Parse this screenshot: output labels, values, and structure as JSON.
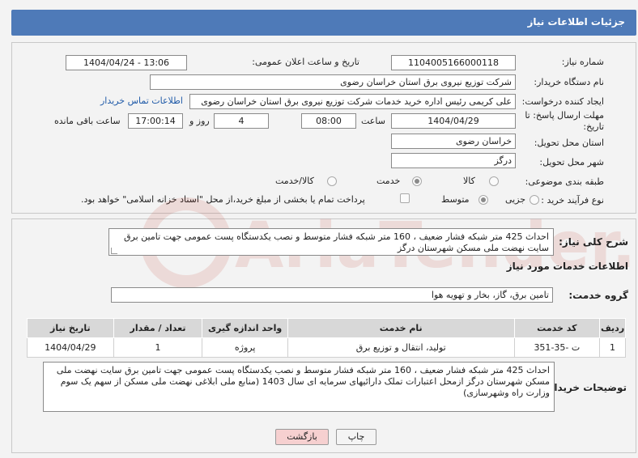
{
  "header": {
    "title": "جزئیات اطلاعات نیاز"
  },
  "need_number": {
    "label": "شماره نیاز:",
    "value": "1104005166000118"
  },
  "announce_datetime": {
    "label": "تاریخ و ساعت اعلان عمومی:",
    "value": "1404/04/24 - 13:06"
  },
  "buyer_org": {
    "label": "نام دستگاه خریدار:",
    "value": "شرکت توزیع نیروی برق استان خراسان رضوی"
  },
  "requester": {
    "label": "ایجاد کننده درخواست:",
    "value": "علی کریمی رئیس اداره خرید خدمات شرکت توزیع نیروی برق استان خراسان رضوی",
    "contact_link": "اطلاعات تماس خریدار"
  },
  "deadline": {
    "label": "مهلت ارسال پاسخ: تا تاریخ:",
    "date": "1404/04/29",
    "time_label": "ساعت",
    "time": "08:00",
    "days": "4",
    "days_label": "روز و",
    "remaining": "17:00:14",
    "remaining_label": "ساعت باقی مانده"
  },
  "delivery_province": {
    "label": "استان محل تحویل:",
    "value": "خراسان رضوی"
  },
  "delivery_city": {
    "label": "شهر محل تحویل:",
    "value": "درگز"
  },
  "category": {
    "label": "طبقه بندی موضوعی:",
    "options": [
      "کالا",
      "خدمت",
      "کالا/خدمت"
    ],
    "selected": "خدمت"
  },
  "purchase_type": {
    "label": "نوع فرآیند خرید :",
    "options": [
      "جزیی",
      "متوسط"
    ],
    "selected": "متوسط",
    "note": "پرداخت تمام یا بخشی از مبلغ خرید،از محل \"اسناد خزانه اسلامی\" خواهد بود."
  },
  "summary": {
    "label": "شرح کلی نیاز:",
    "value": "احداث 425 متر شبکه فشار ضعیف ، 160 متر شبکه فشار متوسط و نصب یکدستگاه پست عمومی جهت تامین برق  سایت نهضت ملی مسکن شهرستان درگز"
  },
  "services_section": {
    "title": "اطلاعات خدمات مورد نیاز"
  },
  "service_group": {
    "label": "گروه خدمت:",
    "value": "تامین برق، گاز، بخار و تهویه هوا"
  },
  "table": {
    "headers": [
      "ردیف",
      "کد خدمت",
      "نام خدمت",
      "واحد اندازه گیری",
      "تعداد / مقدار",
      "تاریخ نیاز"
    ],
    "rows": [
      [
        "1",
        "ت -35-351",
        "تولید، انتقال و توزیع برق",
        "پروژه",
        "1",
        "1404/04/29"
      ]
    ]
  },
  "buyer_notes": {
    "label": "توضیحات خریدار:",
    "value": "احداث 425 متر شبکه فشار ضعیف ، 160 متر شبکه فشار متوسط و نصب یکدستگاه پست عمومی جهت تامین برق  سایت نهضت ملی مسکن شهرستان درگز ازمحل اعتبارات تملک دارائیهای سرمایه ای سال 1403 (منابع ملی ابلاغی نهضت ملی مسکن از سهم یک سوم وزارت راه وشهرسازی)"
  },
  "buttons": {
    "back": "بازگشت",
    "print": "چاپ"
  },
  "watermark": {
    "text": "AriaTender.neT"
  },
  "colors": {
    "header": "#4e7ab8",
    "link": "#1f5aa8",
    "back_button": "#f6d0d0"
  }
}
